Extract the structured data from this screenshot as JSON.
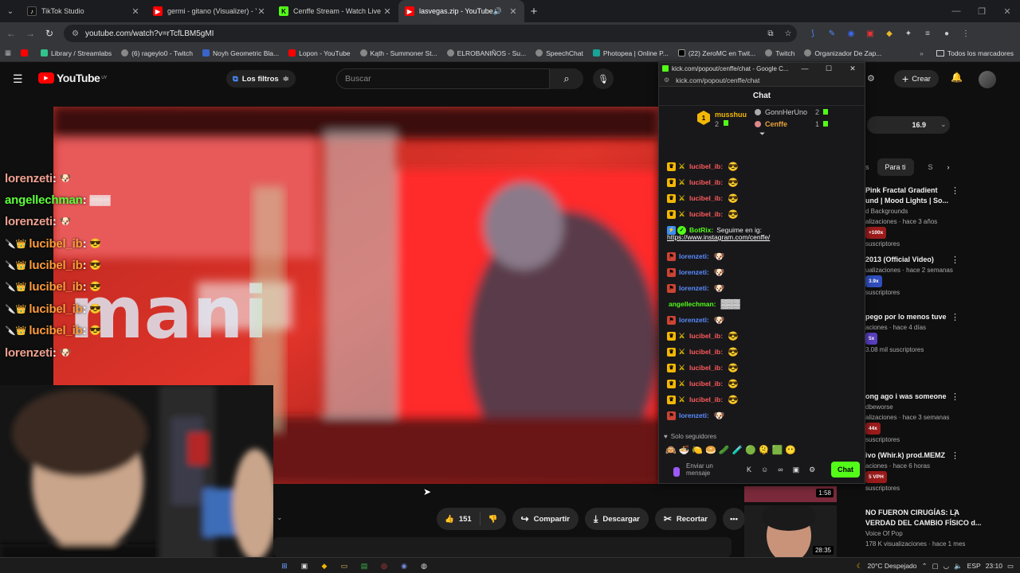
{
  "browser": {
    "tabs": [
      {
        "title": "TikTok Studio",
        "active": false
      },
      {
        "title": "germi - gitano (Visualizer) - YouTube",
        "active": false
      },
      {
        "title": "Cenffe Stream - Watch Live on Kick",
        "active": false
      },
      {
        "title": "lasvegas.zip - YouTube",
        "active": true
      }
    ],
    "url": "youtube.com/watch?v=rTcfLBM5gMI",
    "bookmarks": [
      "Library / Streamlabs",
      "(6) rageylo0 - Twitch",
      "Noyh Geometric Bla...",
      "Lopon - YouTube",
      "Kąth - Summoner St...",
      "ELROBANIÑOS - Su...",
      "SpeechChat",
      "Photopea | Online P...",
      "(22) ZeroMC en Twit...",
      "Twitch",
      "Organizador De Zap..."
    ],
    "bookmarks_folder": "Todos los marcadores"
  },
  "youtube": {
    "logo_text": "YouTube",
    "region": "UY",
    "filters_label": "Los filtros",
    "search_placeholder": "Buscar",
    "create_label": "Crear",
    "speed_value": "16.9",
    "chips": [
      "Para ti"
    ],
    "likes": "151",
    "share_label": "Compartir",
    "download_label": "Descargar",
    "clip_label": "Recortar",
    "recommendations": [
      {
        "title": "Pink Fractal Gradient",
        "title2": "und | Mood Lights | So...",
        "channel": "d Backgrounds",
        "meta": "alizaciones · hace 3 años",
        "badge": "+100x",
        "extra": "suscriptores"
      },
      {
        "title": "2013 (Official Video)",
        "title2": "",
        "channel": "ualizaciones · hace 2 semanas",
        "meta": "",
        "badge": "3.9x",
        "extra": "suscriptores"
      },
      {
        "title": "pego por lo menos tuve",
        "title2": "",
        "channel": "",
        "meta": "aciones · hace 4 días",
        "badge": "5x",
        "extra": "3.08 mil suscriptores"
      },
      {
        "title": "ong ago i was someone",
        "title2": "",
        "channel": "dbeworse",
        "meta": "alizaciones · hace 3 semanas",
        "badge": "44x",
        "extra": "suscriptores"
      },
      {
        "title": "ivo (Whir.k) prod.MEMZ",
        "title2": "",
        "channel": "",
        "meta": "aciones · hace 6 horas",
        "badge": "5 VPH",
        "extra": "suscriptores"
      },
      {
        "title": "NO FUERON CIRUGÍAS: LA",
        "title2": "VERDAD DEL CAMBIO FÍSICO d...",
        "channel": "Voice Of Pop",
        "meta": "178 K visualizaciones · hace 1 mes",
        "badge": "",
        "extra": ""
      }
    ],
    "thumb_durations": [
      "1:58",
      "28:35"
    ]
  },
  "overlay": {
    "lines": [
      {
        "user": "lorenzeti",
        "color": "#f0a090"
      },
      {
        "user": "angellechman",
        "color": "#5dff3a"
      },
      {
        "user": "lorenzeti",
        "color": "#f0a090"
      },
      {
        "user": "lucibel_ib",
        "color": "#ff9a3a"
      },
      {
        "user": "lucibel_ib",
        "color": "#ff9a3a"
      },
      {
        "user": "lucibel_ib",
        "color": "#ff9a3a"
      },
      {
        "user": "lucibel_ib",
        "color": "#ff9a3a"
      },
      {
        "user": "lucibel_ib",
        "color": "#ff9a3a"
      },
      {
        "user": "lorenzeti",
        "color": "#f0a090"
      }
    ],
    "video_text": "mani"
  },
  "chat_popup": {
    "window_title": "kick.com/popout/cenffe/chat - Google C...",
    "url": "kick.com/popout/cenffe/chat",
    "header": "Chat",
    "leaderboard": [
      {
        "rank": "1",
        "name": "musshuu",
        "count": "2"
      },
      {
        "rank": "",
        "name": "GonnHerUno",
        "count": "2"
      },
      {
        "rank": "",
        "name": "Cenffe",
        "count": "1"
      }
    ],
    "messages": [
      {
        "user": "lucibel_ib:",
        "color": "#ff5b5b",
        "text": "",
        "type": "crown"
      },
      {
        "user": "lucibel_ib:",
        "color": "#ff5b5b",
        "text": "",
        "type": "crown"
      },
      {
        "user": "lucibel_ib:",
        "color": "#ff5b5b",
        "text": "",
        "type": "crown"
      },
      {
        "user": "lucibel_ib:",
        "color": "#ff5b5b",
        "text": "",
        "type": "crown"
      },
      {
        "user": "BotRix:",
        "color": "#53fc18",
        "text": "Seguime en ig:",
        "type": "bot"
      },
      {
        "user": "lorenzeti:",
        "color": "#5b8cff",
        "text": "",
        "type": "sub"
      },
      {
        "user": "lorenzeti:",
        "color": "#5b8cff",
        "text": "",
        "type": "sub"
      },
      {
        "user": "lorenzeti:",
        "color": "#5b8cff",
        "text": "",
        "type": "sub"
      },
      {
        "user": "angellechman:",
        "color": "#53fc18",
        "text": "",
        "type": "plain"
      },
      {
        "user": "lorenzeti:",
        "color": "#5b8cff",
        "text": "",
        "type": "sub"
      },
      {
        "user": "lucibel_ib:",
        "color": "#ff5b5b",
        "text": "",
        "type": "crown"
      },
      {
        "user": "lucibel_ib:",
        "color": "#ff5b5b",
        "text": "",
        "type": "crown"
      },
      {
        "user": "lucibel_ib:",
        "color": "#ff5b5b",
        "text": "",
        "type": "crown"
      },
      {
        "user": "lucibel_ib:",
        "color": "#ff5b5b",
        "text": "",
        "type": "crown"
      },
      {
        "user": "lucibel_ib:",
        "color": "#ff5b5b",
        "text": "",
        "type": "crown"
      },
      {
        "user": "lorenzeti:",
        "color": "#5b8cff",
        "text": "",
        "type": "sub"
      }
    ],
    "bot_link": "https://www.instagram.com/cenffe/",
    "followers_only": "Solo seguidores",
    "input_placeholder": "Enviar un mensaje",
    "chat_button": "Chat"
  },
  "taskbar": {
    "weather": "20°C  Despejado",
    "lang": "ESP",
    "time": "23:10"
  }
}
